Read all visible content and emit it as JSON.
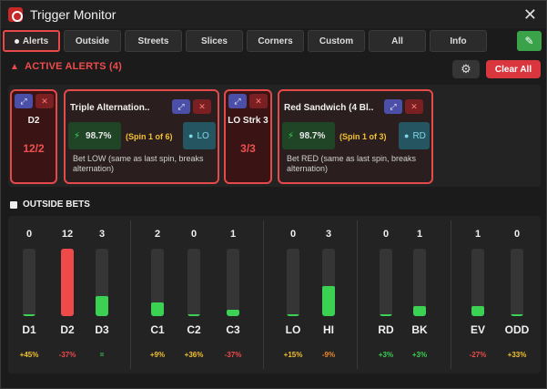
{
  "window": {
    "title": "Trigger Monitor",
    "close_icon": "close-icon"
  },
  "tabs": [
    {
      "label": "Alerts",
      "active": true
    },
    {
      "label": "Outside",
      "active": false
    },
    {
      "label": "Streets",
      "active": false
    },
    {
      "label": "Slices",
      "active": false
    },
    {
      "label": "Corners",
      "active": false
    },
    {
      "label": "Custom",
      "active": false
    },
    {
      "label": "All",
      "active": false
    },
    {
      "label": "Info",
      "active": false
    }
  ],
  "alerts": {
    "header": "ACTIVE ALERTS (4)",
    "clear_label": "Clear All",
    "cards": [
      {
        "title": "D2",
        "count": "12/2"
      },
      {
        "title": "Triple Alternation..",
        "pct": "98.7%",
        "spin": "(Spin 1 of 6)",
        "bet": "LO",
        "desc": "Bet LOW (same as last spin, breaks alternation)"
      },
      {
        "title": "LO Strk 3",
        "count": "3/3"
      },
      {
        "title": "Red Sandwich (4 Bl..",
        "pct": "98.7%",
        "spin": "(Spin 1 of 3)",
        "bet": "RD",
        "desc": "Bet RED (same as last spin, breaks alternation)"
      }
    ]
  },
  "outside": {
    "header": "OUTSIDE BETS",
    "bets": [
      {
        "label": "D1",
        "count": "0",
        "pct": "+45%",
        "fill": 0.03,
        "hot": false,
        "pct_color": "#f2c230"
      },
      {
        "label": "D2",
        "count": "12",
        "pct": "-37%",
        "fill": 1.0,
        "hot": true,
        "pct_color": "#ef4a4a"
      },
      {
        "label": "D3",
        "count": "3",
        "pct": "=",
        "fill": 0.3,
        "hot": false,
        "pct_color": "#3bd152"
      },
      {
        "label": "C1",
        "count": "2",
        "pct": "+9%",
        "fill": 0.2,
        "hot": false,
        "pct_color": "#f2c230"
      },
      {
        "label": "C2",
        "count": "0",
        "pct": "+36%",
        "fill": 0.03,
        "hot": false,
        "pct_color": "#f2c230"
      },
      {
        "label": "C3",
        "count": "1",
        "pct": "-37%",
        "fill": 0.1,
        "hot": false,
        "pct_color": "#ef4a4a"
      },
      {
        "label": "LO",
        "count": "0",
        "pct": "+15%",
        "fill": 0.03,
        "hot": false,
        "pct_color": "#f2c230"
      },
      {
        "label": "HI",
        "count": "3",
        "pct": "-9%",
        "fill": 0.44,
        "hot": false,
        "pct_color": "#ef8a2a"
      },
      {
        "label": "RD",
        "count": "0",
        "pct": "+3%",
        "fill": 0.03,
        "hot": false,
        "pct_color": "#3bd152"
      },
      {
        "label": "BK",
        "count": "1",
        "pct": "+3%",
        "fill": 0.15,
        "hot": false,
        "pct_color": "#3bd152"
      },
      {
        "label": "EV",
        "count": "1",
        "pct": "-27%",
        "fill": 0.15,
        "hot": false,
        "pct_color": "#ef4a4a"
      },
      {
        "label": "ODD",
        "count": "0",
        "pct": "+33%",
        "fill": 0.03,
        "hot": false,
        "pct_color": "#f2c230"
      }
    ]
  }
}
